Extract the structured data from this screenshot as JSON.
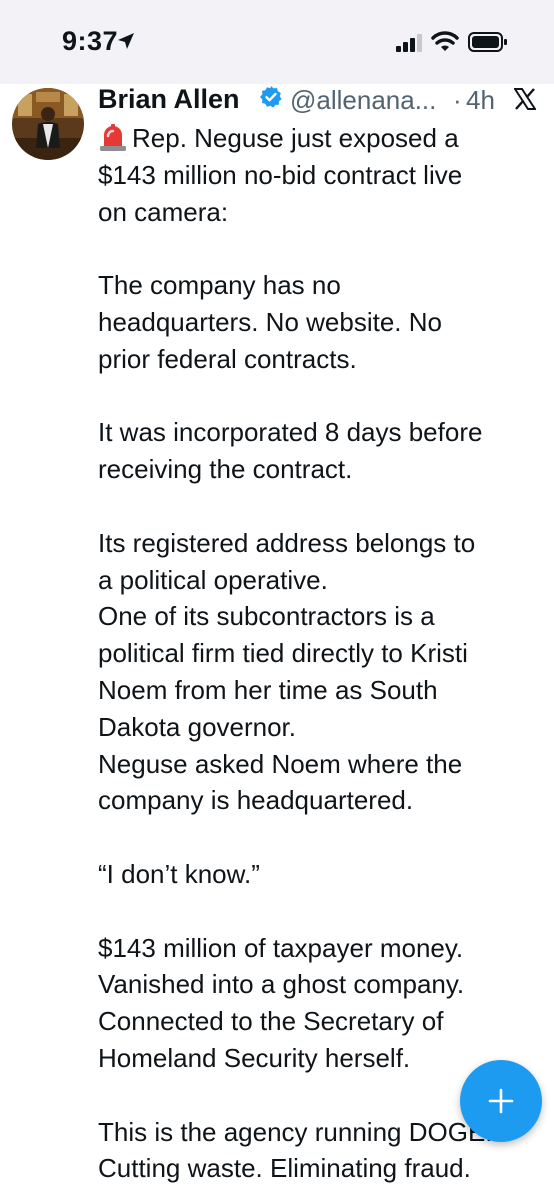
{
  "status_bar": {
    "time": "9:37",
    "icons": [
      "location-arrow-icon",
      "cellular-signal-icon",
      "wifi-icon",
      "battery-icon"
    ]
  },
  "tweet": {
    "author": {
      "display_name": "Brian Allen",
      "handle": "@allenana...",
      "verified": true
    },
    "separator": "·",
    "time": "4h",
    "lines": [
      "Rep. Neguse just exposed a",
      "$143 million no-bid contract live",
      "on camera:",
      "",
      "The company has no",
      "headquarters. No website. No",
      "prior federal contracts.",
      "",
      "It was incorporated 8 days before",
      "receiving the contract.",
      "",
      "Its registered address belongs to",
      "a political operative.",
      "One of its subcontractors is a",
      "political firm tied directly to Kristi",
      "Noem from her time as South",
      "Dakota governor.",
      "Neguse asked Noem where the",
      "company is headquartered.",
      "",
      "“I don’t know.”",
      "",
      "$143 million of taxpayer money.",
      "Vanished into a ghost company.",
      "Connected to the Secretary of",
      "Homeland Security herself.",
      "",
      "This is the agency running DOGE.",
      "Cutting waste. Eliminating fraud."
    ]
  },
  "colors": {
    "accent": "#1d9bf0",
    "text": "#0f1419",
    "secondary": "#536471",
    "status_bg": "#f2f2f7"
  }
}
